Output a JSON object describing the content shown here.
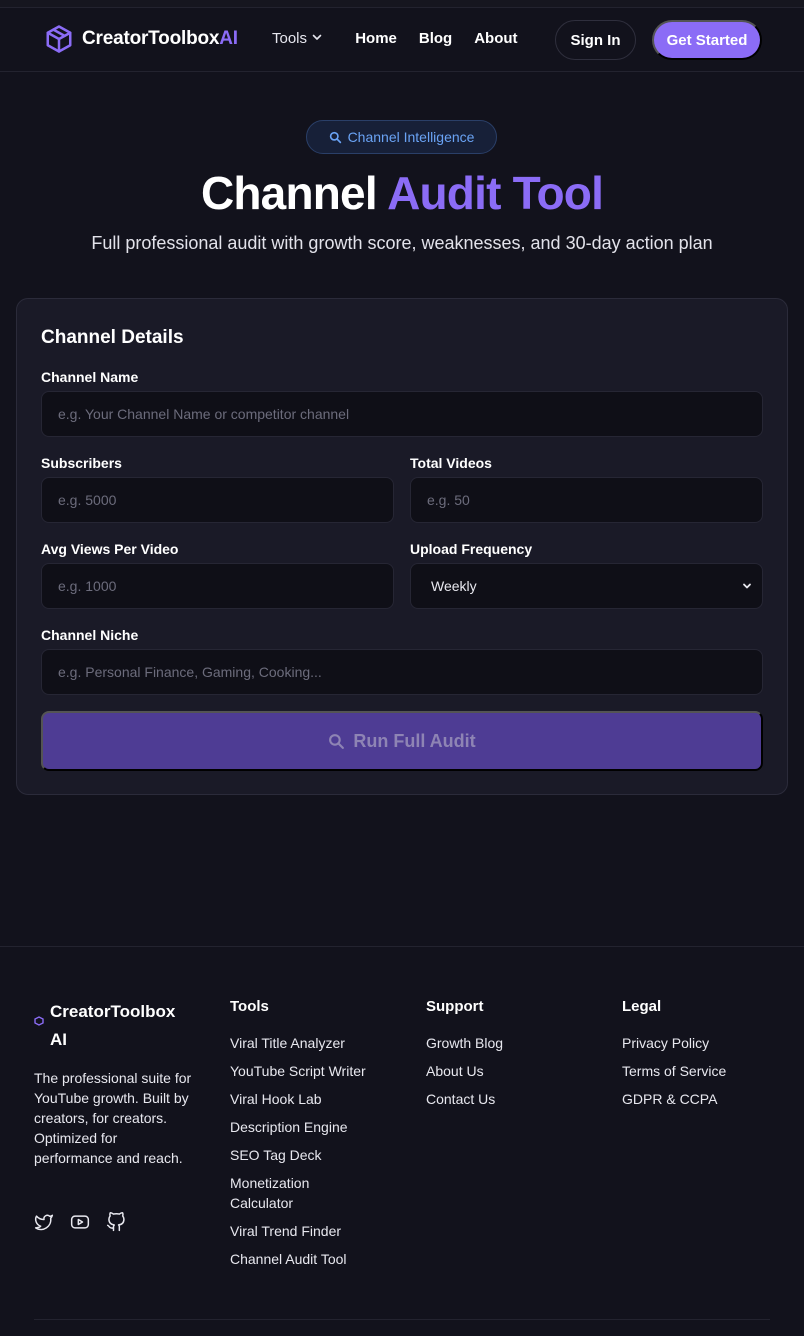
{
  "nav": {
    "brand_main": "CreatorToolbox",
    "brand_ai": "AI",
    "tools": "Tools",
    "home": "Home",
    "blog": "Blog",
    "about": "About",
    "sign_in": "Sign In",
    "get_started": "Get Started"
  },
  "hero": {
    "badge": "Channel Intelligence",
    "title_main": "Channel",
    "title_accent": "Audit Tool",
    "subtitle": "Full professional audit with growth score, weaknesses, and 30-day action plan"
  },
  "form": {
    "title": "Channel Details",
    "channel_name_label": "Channel Name",
    "channel_name_placeholder": "e.g. Your Channel Name or competitor channel",
    "subscribers_label": "Subscribers",
    "subscribers_placeholder": "e.g. 5000",
    "total_videos_label": "Total Videos",
    "total_videos_placeholder": "e.g. 50",
    "avg_views_label": "Avg Views Per Video",
    "avg_views_placeholder": "e.g. 1000",
    "upload_freq_label": "Upload Frequency",
    "upload_freq_value": "Weekly",
    "niche_label": "Channel Niche",
    "niche_placeholder": "e.g. Personal Finance, Gaming, Cooking...",
    "run_button": "Run Full Audit"
  },
  "footer": {
    "brand_line1": "CreatorToolbox",
    "brand_line2": "AI",
    "description": "The professional suite for YouTube growth. Built by creators, for creators. Optimized for performance and reach.",
    "tools": {
      "heading": "Tools",
      "items": [
        "Viral Title Analyzer",
        "YouTube Script Writer",
        "Viral Hook Lab",
        "Description Engine",
        "SEO Tag Deck",
        "Monetization Calculator",
        "Viral Trend Finder",
        "Channel Audit Tool"
      ]
    },
    "support": {
      "heading": "Support",
      "items": [
        "Growth Blog",
        "About Us",
        "Contact Us"
      ]
    },
    "legal": {
      "heading": "Legal",
      "items": [
        "Privacy Policy",
        "Terms of Service",
        "GDPR & CCPA"
      ]
    }
  },
  "colors": {
    "accent": "#8b6cf6",
    "background": "#12121c",
    "card": "#1a1a27",
    "badge_text": "#6aa3f5"
  },
  "icons": [
    "cube-logo-icon",
    "chevron-down-icon",
    "search-icon",
    "twitter-icon",
    "youtube-icon",
    "github-icon"
  ]
}
